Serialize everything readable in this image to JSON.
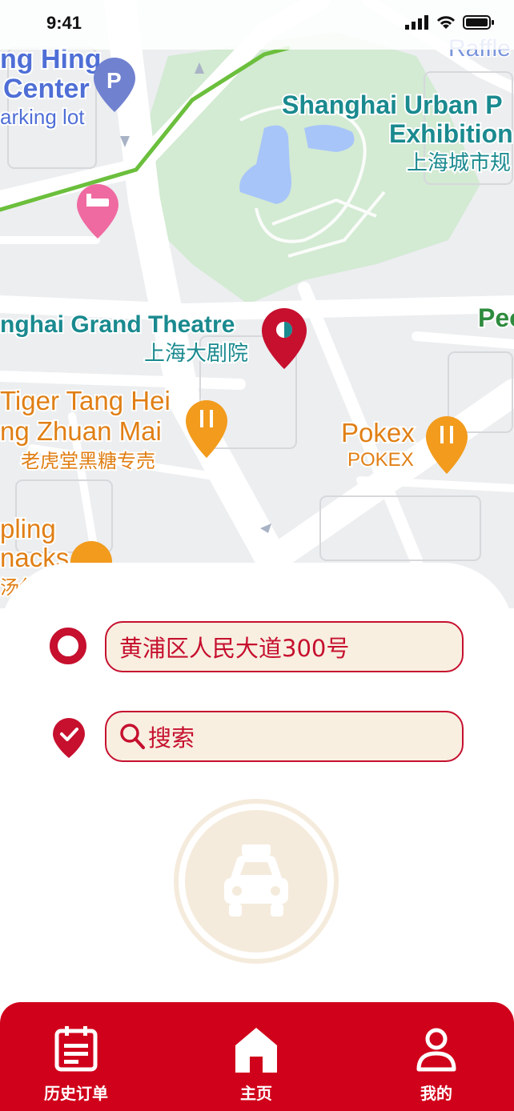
{
  "status_bar": {
    "time": "9:41"
  },
  "map": {
    "labels": {
      "hing_line1": "ng Hing",
      "hing_line2": "Center",
      "parking": "arking lot",
      "urban_line1": "Shanghai Urban P",
      "urban_line2": "Exhibition",
      "urban_cn": "上海城市规",
      "raffles": "Raffle",
      "theatre": "nghai Grand Theatre",
      "theatre_cn": "上海大剧院",
      "peo": "Peo",
      "tiger_line1": "Tiger Tang Hei",
      "tiger_line2": "ng Zhuan Mai",
      "tiger_cn": "老虎堂黑糖专売",
      "pokex": "Pokex",
      "pokex_sub": "POKEX",
      "dumpling_line1": "pling",
      "dumpling_line2": "nacks",
      "dumpling_cn": "汤包"
    },
    "colors": {
      "background": "#eceef0",
      "park": "#d3ead3",
      "water": "#a7c5f9",
      "road": "#ffffff",
      "route": "#6bbf3c",
      "teal_label": "#1a8a8f",
      "orange_label": "#e07f15"
    }
  },
  "form": {
    "start_value": "黄浦区人民大道300号",
    "destination_placeholder": "搜索",
    "accent": "#c6102e",
    "field_bg": "#f8efe1"
  },
  "call_button": {
    "icon": "taxi-icon"
  },
  "tabbar": {
    "background": "#d0021b",
    "items": [
      {
        "label": "历史订单",
        "icon": "calendar-icon"
      },
      {
        "label": "主页",
        "icon": "home-icon"
      },
      {
        "label": "我的",
        "icon": "user-icon"
      }
    ]
  }
}
